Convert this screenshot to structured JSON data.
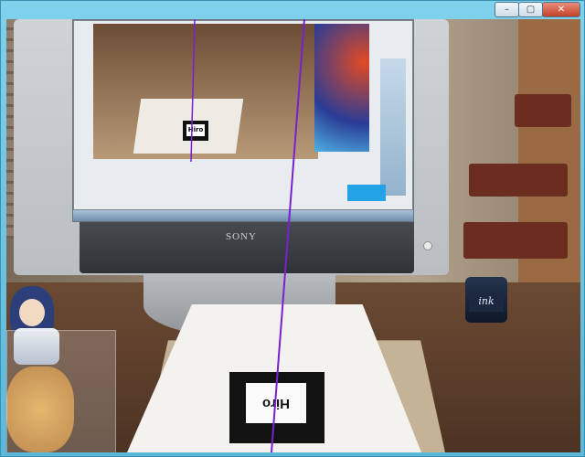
{
  "window": {
    "title": "",
    "caption": {
      "minimize": "–",
      "maximize": "▢",
      "close": "✕"
    }
  },
  "scene": {
    "monitor_brand": "SONY",
    "marker_text": "Hiro",
    "inner_marker_text": "Hiro",
    "bottle_label": "ink",
    "line_color": "#7a1fd1"
  }
}
